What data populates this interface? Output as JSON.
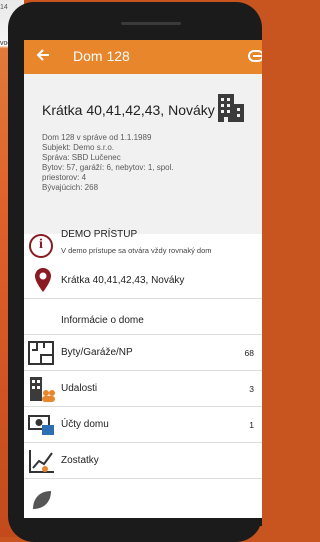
{
  "background": {
    "text_top": "14",
    "text_mid": "vod"
  },
  "appbar": {
    "title": "Dom 128",
    "back_icon": "arrow-left-icon",
    "menu_icon": "menu-icon"
  },
  "building": {
    "address": "Krátka 40,41,42,43, Nováky",
    "details": [
      "Dom 128 v správe od 1.1.1989",
      "Subjekt: Demo s.r.o.",
      "Správa: SBD Lučenec",
      "Bytov: 57, garáží: 6, nebytov: 1, spol.",
      "priestorov: 4",
      "Bývajúcich: 268"
    ]
  },
  "demo": {
    "title": "DEMO PRÍSTUP",
    "description": "V demo prístupe sa otvára vždy rovnaký dom"
  },
  "location": {
    "label": "Krátka 40,41,42,43, Nováky"
  },
  "info_link": {
    "label": "Informácie o dome"
  },
  "menu": [
    {
      "label": "Byty/Garáže/NP",
      "count": "68",
      "icon": "floorplan-icon"
    },
    {
      "label": "Udalosti",
      "count": "3",
      "icon": "building-people-icon"
    },
    {
      "label": "Účty domu",
      "count": "1",
      "icon": "money-icon"
    },
    {
      "label": "Zostatky",
      "count": "",
      "icon": "chart-icon"
    }
  ],
  "colors": {
    "appbar": "#e8862c",
    "accent": "#8a1b23",
    "background": "#c8541f"
  }
}
